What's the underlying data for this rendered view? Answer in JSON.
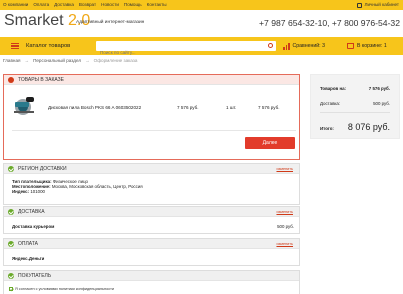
{
  "topbar": {
    "nav": [
      "О компании",
      "Оплата",
      "Доставка",
      "Возврат",
      "Новости",
      "Помощь",
      "Контакты"
    ],
    "cabinet": "Личный кабинет"
  },
  "header": {
    "logo_main": "Smarket",
    "logo_version": " 2.0",
    "tagline": "Адаптивный интернет-магазин",
    "phones": "+7 987 654-32-10, +7 800 976-54-32"
  },
  "navbar": {
    "catalog": "Каталог товаров",
    "search_placeholder": "Поиск по сайту...",
    "compare": "Сравнений: 3",
    "cart": "В корзине: 1"
  },
  "breadcrumbs": [
    "Главная",
    "Персональный раздел",
    "Оформление заказа"
  ],
  "orders": {
    "title": "ТОВАРЫ В ЗАКАЗЕ",
    "product": {
      "name": "Дисковая пила Bosch PKS 66 A 0603502022",
      "price": "7 576 руб.",
      "qty": "1 шт.",
      "sum": "7 576 руб."
    },
    "next_button": "Далее"
  },
  "region": {
    "title": "РЕГИОН ДОСТАВКИ",
    "edit": "изменить",
    "rows": [
      {
        "label": "Тип плательщика:",
        "value": "Физическое лицо"
      },
      {
        "label": "Местоположение:",
        "value": "Москва, Московская область, Центр, Россия"
      },
      {
        "label": "Индекс:",
        "value": "101000"
      }
    ]
  },
  "delivery": {
    "title": "ДОСТАВКА",
    "edit": "изменить",
    "method": "Доставка курьером",
    "cost": "500 руб."
  },
  "payment": {
    "title": "ОПЛАТА",
    "edit": "изменить",
    "method": "Яндекс.Деньги"
  },
  "buyer": {
    "title": "ПОКУПАТЕЛЬ",
    "agree": "Я согласен с условиями политики конфиденциальности"
  },
  "summary": {
    "goods_label": "Товаров на:",
    "goods_value": "7 576 руб.",
    "shipping_label": "Доставка:",
    "shipping_value": "500 руб.",
    "total_label": "Итого:",
    "total_value": "8 076 руб."
  },
  "colors": {
    "brand_yellow": "#f7c51b",
    "accent_red": "#d03a18",
    "button_red": "#e23b2b",
    "ok_green": "#6aaa2a"
  }
}
